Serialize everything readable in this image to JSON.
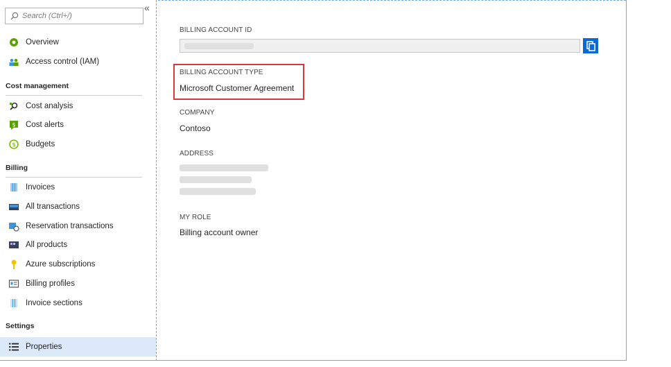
{
  "search": {
    "placeholder": "Search (Ctrl+/)"
  },
  "collapse_glyph": "«",
  "sidebar": {
    "top_items": [
      {
        "label": "Overview",
        "icon": "overview-icon"
      },
      {
        "label": "Access control (IAM)",
        "icon": "iam-icon"
      }
    ],
    "sections": [
      {
        "title": "Cost management",
        "items": [
          {
            "label": "Cost analysis",
            "icon": "cost-analysis-icon"
          },
          {
            "label": "Cost alerts",
            "icon": "cost-alerts-icon"
          },
          {
            "label": "Budgets",
            "icon": "budgets-icon"
          }
        ]
      },
      {
        "title": "Billing",
        "items": [
          {
            "label": "Invoices",
            "icon": "invoices-icon"
          },
          {
            "label": "All transactions",
            "icon": "transactions-icon"
          },
          {
            "label": "Reservation transactions",
            "icon": "reservation-icon"
          },
          {
            "label": "All products",
            "icon": "products-icon"
          },
          {
            "label": "Azure subscriptions",
            "icon": "key-icon"
          },
          {
            "label": "Billing profiles",
            "icon": "billing-profiles-icon"
          },
          {
            "label": "Invoice sections",
            "icon": "invoice-sections-icon"
          }
        ]
      },
      {
        "title": "Settings",
        "items": [
          {
            "label": "Properties",
            "icon": "properties-icon",
            "selected": true
          }
        ]
      }
    ]
  },
  "properties": {
    "billing_account_id": {
      "label": "BILLING ACCOUNT ID"
    },
    "billing_account_type": {
      "label": "BILLING ACCOUNT TYPE",
      "value": "Microsoft Customer Agreement"
    },
    "company": {
      "label": "COMPANY",
      "value": "Contoso"
    },
    "address": {
      "label": "ADDRESS"
    },
    "my_role": {
      "label": "MY ROLE",
      "value": "Billing account owner"
    }
  },
  "colors": {
    "accent": "#0a6ad4",
    "highlight": "#d9363e",
    "selected_bg": "#dbe9f8"
  }
}
